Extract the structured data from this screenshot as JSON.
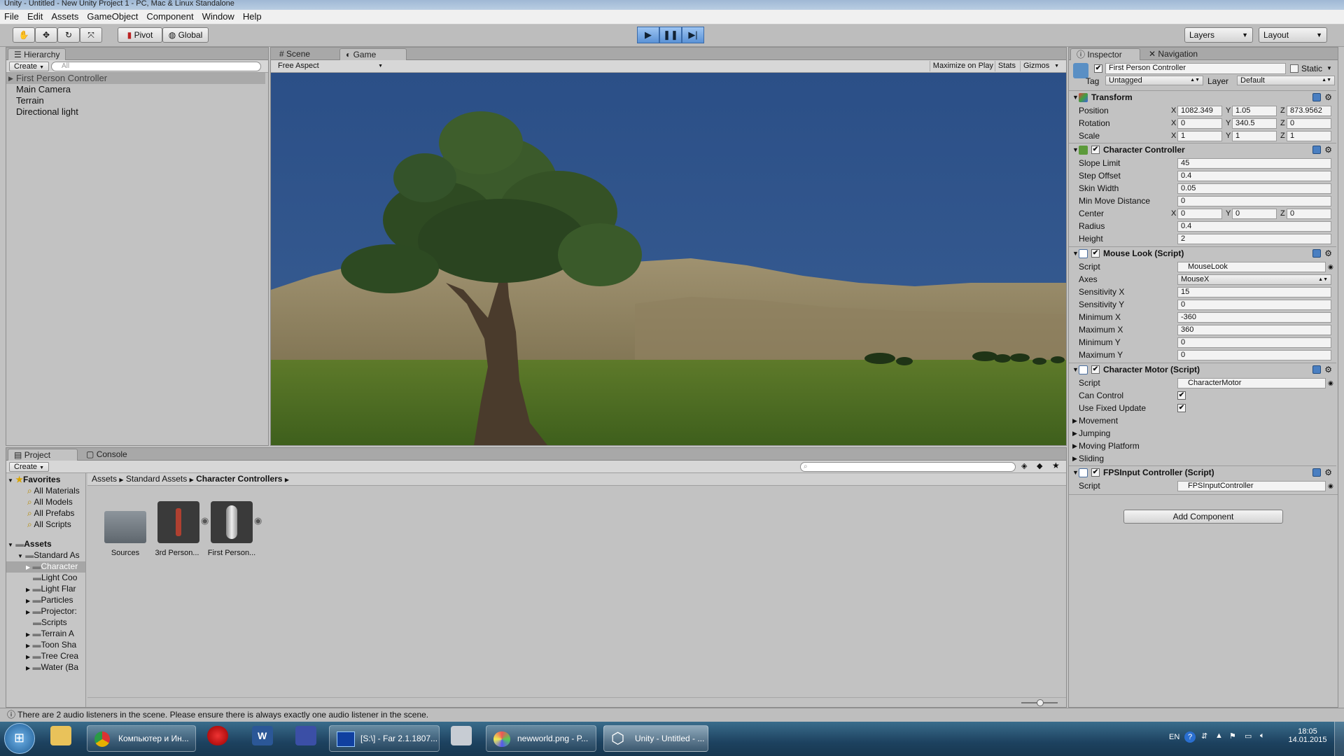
{
  "window": {
    "title": "Unity - Untitled - New Unity Project 1 - PC, Mac & Linux Standalone"
  },
  "menu": [
    "File",
    "Edit",
    "Assets",
    "GameObject",
    "Component",
    "Window",
    "Help"
  ],
  "toolbar": {
    "pivot": "Pivot",
    "global": "Global",
    "layers": "Layers",
    "layout": "Layout"
  },
  "hierarchy": {
    "tab": "Hierarchy",
    "create": "Create",
    "search_placeholder": "All",
    "items": [
      "First Person Controller",
      "Main Camera",
      "Terrain",
      "Directional light"
    ]
  },
  "scene_tabs": {
    "scene": "Scene",
    "game": "Game",
    "aspect": "Free Aspect",
    "maximize": "Maximize on Play",
    "stats": "Stats",
    "gizmos": "Gizmos"
  },
  "inspector": {
    "tab": "Inspector",
    "nav_tab": "Navigation",
    "object_name": "First Person Controller",
    "static": "Static",
    "tag_label": "Tag",
    "tag": "Untagged",
    "layer_label": "Layer",
    "layer": "Default",
    "transform": {
      "title": "Transform",
      "position": {
        "label": "Position",
        "x": "1082.349",
        "y": "1.05",
        "z": "873.9562"
      },
      "rotation": {
        "label": "Rotation",
        "x": "0",
        "y": "340.5",
        "z": "0"
      },
      "scale": {
        "label": "Scale",
        "x": "1",
        "y": "1",
        "z": "1"
      }
    },
    "char_controller": {
      "title": "Character Controller",
      "slope_limit": {
        "label": "Slope Limit",
        "value": "45"
      },
      "step_offset": {
        "label": "Step Offset",
        "value": "0.4"
      },
      "skin_width": {
        "label": "Skin Width",
        "value": "0.05"
      },
      "min_move": {
        "label": "Min Move Distance",
        "value": "0"
      },
      "center": {
        "label": "Center",
        "x": "0",
        "y": "0",
        "z": "0"
      },
      "radius": {
        "label": "Radius",
        "value": "0.4"
      },
      "height": {
        "label": "Height",
        "value": "2"
      }
    },
    "mouse_look": {
      "title": "Mouse Look (Script)",
      "script": {
        "label": "Script",
        "value": "MouseLook"
      },
      "axes": {
        "label": "Axes",
        "value": "MouseX"
      },
      "sens_x": {
        "label": "Sensitivity X",
        "value": "15"
      },
      "sens_y": {
        "label": "Sensitivity Y",
        "value": "0"
      },
      "min_x": {
        "label": "Minimum X",
        "value": "-360"
      },
      "max_x": {
        "label": "Maximum X",
        "value": "360"
      },
      "min_y": {
        "label": "Minimum Y",
        "value": "0"
      },
      "max_y": {
        "label": "Maximum Y",
        "value": "0"
      }
    },
    "char_motor": {
      "title": "Character Motor (Script)",
      "script": {
        "label": "Script",
        "value": "CharacterMotor"
      },
      "can_control": "Can Control",
      "fixed_update": "Use Fixed Update",
      "folds": [
        "Movement",
        "Jumping",
        "Moving Platform",
        "Sliding"
      ]
    },
    "fps_input": {
      "title": "FPSInput Controller (Script)",
      "script": {
        "label": "Script",
        "value": "FPSInputController"
      }
    },
    "add_component": "Add Component"
  },
  "project": {
    "tab": "Project",
    "console_tab": "Console",
    "create": "Create",
    "favorites_label": "Favorites",
    "favorites": [
      "All Materials",
      "All Models",
      "All Prefabs",
      "All Scripts"
    ],
    "assets_label": "Assets",
    "standard_assets": "Standard As",
    "asset_folders": [
      "Character",
      "Light Coo",
      "Light Flar",
      "Particles",
      "Projector:",
      "Scripts",
      "Terrain A",
      "Toon Sha",
      "Tree Crea",
      "Water (Ba"
    ],
    "breadcrumb": [
      "Assets",
      "Standard Assets",
      "Character Controllers"
    ],
    "tiles": [
      "Sources",
      "3rd Person...",
      "First Person..."
    ]
  },
  "status": "There are 2 audio listeners in the scene. Please ensure there is always exactly one audio listener in the scene.",
  "taskbar": {
    "items": [
      "Компьютер и Ин...",
      "",
      "",
      "",
      "[S:\\] - Far 2.1.1807...",
      "",
      "newworld.png - P...",
      "Unity - Untitled - ..."
    ],
    "lang": "EN",
    "time": "18:05",
    "date": "14.01.2015"
  }
}
